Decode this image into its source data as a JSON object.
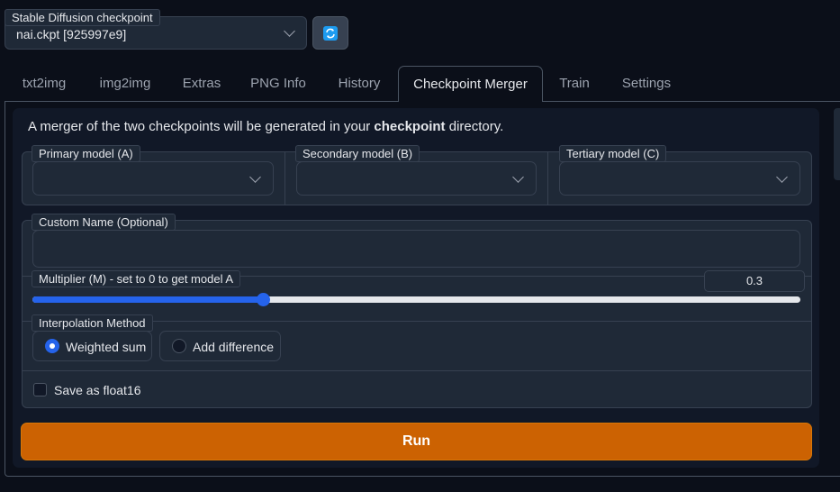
{
  "checkpoint": {
    "label": "Stable Diffusion checkpoint",
    "selected": "nai.ckpt [925997e9]",
    "refresh_icon": "refresh-icon"
  },
  "tabs": [
    {
      "label": "txt2img"
    },
    {
      "label": "img2img"
    },
    {
      "label": "Extras"
    },
    {
      "label": "PNG Info"
    },
    {
      "label": "History"
    },
    {
      "label": "Checkpoint Merger"
    },
    {
      "label": "Train"
    },
    {
      "label": "Settings"
    }
  ],
  "active_tab": "Checkpoint Merger",
  "merger": {
    "description_before": "A merger of the two checkpoints will be generated in your ",
    "description_bold": "checkpoint",
    "description_after": " directory.",
    "primary_label": "Primary model (A)",
    "secondary_label": "Secondary model (B)",
    "tertiary_label": "Tertiary model (C)",
    "custom_name_label": "Custom Name (Optional)",
    "custom_name_value": "",
    "multiplier_label": "Multiplier (M) - set to 0 to get model A",
    "multiplier_value": "0.3",
    "multiplier_fraction": 0.3,
    "interpolation_label": "Interpolation Method",
    "interpolation_options": [
      {
        "label": "Weighted sum",
        "selected": true
      },
      {
        "label": "Add difference",
        "selected": false
      }
    ],
    "float16_label": "Save as float16",
    "float16_checked": false,
    "run_label": "Run"
  },
  "colors": {
    "accent": "#2563eb",
    "run_button": "#cc6202",
    "panel": "#1f2937",
    "background": "#0b0f19"
  }
}
